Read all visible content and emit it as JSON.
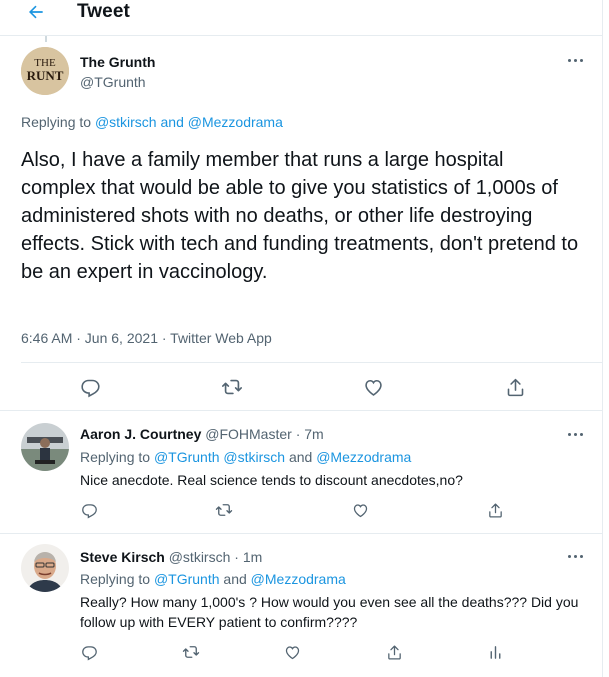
{
  "header": {
    "title": "Tweet"
  },
  "main_tweet": {
    "author_name": "The Grunth",
    "author_handle": "@TGrunth",
    "avatar_text_top": "THE",
    "avatar_text_bottom": "RUNT",
    "replying_prefix": "Replying to",
    "replying_user1": "@stkirsch",
    "replying_and": "and",
    "replying_user2": "@Mezzodrama",
    "text": "Also, I have a family member that runs a large hospital complex that would be able to give you statistics of 1,000s of administered shots with no deaths, or other life destroying effects. Stick with tech and funding treatments, don't pretend to be an expert in vaccinology.",
    "meta": "6:46 AM · Jun 6, 2021 · Twitter Web App"
  },
  "replies": [
    {
      "name": "Aaron J. Courtney",
      "handle": "@FOHMaster",
      "time": "· 7m",
      "replying_prefix": "Replying to",
      "replying_users": "@TGrunth @stkirsch",
      "replying_and": "and",
      "replying_last": "@Mezzodrama",
      "text": "Nice anecdote. Real science tends to discount anecdotes,no?"
    },
    {
      "name": "Steve Kirsch",
      "handle": "@stkirsch",
      "time": "· 1m",
      "replying_prefix": "Replying to",
      "replying_users": "@TGrunth",
      "replying_and": "and",
      "replying_last": "@Mezzodrama",
      "text": "Really? How many 1,000's ? How would you even see all the deaths???  Did you follow up with EVERY patient to confirm????"
    }
  ],
  "colors": {
    "accent": "#1b95e0",
    "text": "#0f1419",
    "muted": "#536471",
    "border": "#e6ecf0"
  },
  "icons": [
    "back-arrow-icon",
    "more-icon",
    "reply-icon",
    "retweet-icon",
    "like-icon",
    "share-icon",
    "analytics-icon"
  ]
}
